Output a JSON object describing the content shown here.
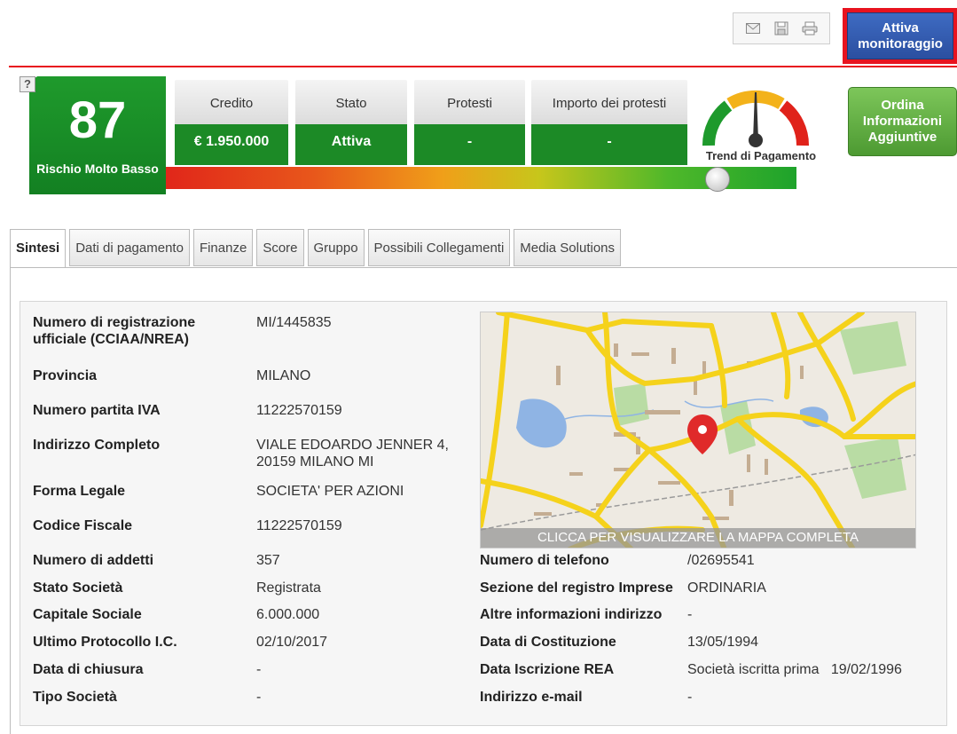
{
  "toolbar": {
    "icons": [
      "mail-icon",
      "save-icon",
      "print-icon"
    ],
    "monitor_button": "Attiva monitoraggio"
  },
  "score": {
    "help": "?",
    "value": "87",
    "label": "Rischio Molto Basso"
  },
  "metrics": [
    {
      "title": "Credito",
      "value": "€ 1.950.000"
    },
    {
      "title": "Stato",
      "value": "Attiva"
    },
    {
      "title": "Protesti",
      "value": "-"
    },
    {
      "title": "Importo dei protesti",
      "value": "-"
    }
  ],
  "gauge": {
    "label": "Trend di Pagamento"
  },
  "order_button": "Ordina Informazioni Aggiuntive",
  "tabs": [
    "Sintesi",
    "Dati di pagamento",
    "Finanze",
    "Score",
    "Gruppo",
    "Possibili Collegamenti",
    "Media Solutions"
  ],
  "active_tab": "Sintesi",
  "details_left": [
    {
      "label": "Numero di registrazione ufficiale (CCIAA/NREA)",
      "value": "MI/1445835"
    },
    {
      "label": "Provincia",
      "value": "MILANO"
    },
    {
      "label": "Numero partita IVA",
      "value": "11222570159"
    },
    {
      "label": "Indirizzo Completo",
      "value": "VIALE EDOARDO JENNER 4, 20159 MILANO MI"
    },
    {
      "label": "Forma Legale",
      "value": "SOCIETA' PER AZIONI"
    },
    {
      "label": "Codice Fiscale",
      "value": "11222570159"
    },
    {
      "label": "Numero di addetti",
      "value": "357"
    },
    {
      "label": "Stato Società",
      "value": "Registrata"
    },
    {
      "label": "Capitale Sociale",
      "value": "6.000.000"
    },
    {
      "label": "Ultimo Protocollo I.C.",
      "value": "02/10/2017"
    },
    {
      "label": "Data di chiusura",
      "value": "-"
    },
    {
      "label": "Tipo Società",
      "value": "-"
    }
  ],
  "details_right": [
    {
      "label": "Numero di telefono",
      "value": "/02695541"
    },
    {
      "label": "Sezione del registro Imprese",
      "value": "ORDINARIA"
    },
    {
      "label": "Altre informazioni indirizzo",
      "value": "-"
    },
    {
      "label": "Data di Costituzione",
      "value": "13/05/1994"
    },
    {
      "label": "Data Iscrizione REA",
      "value": "Società iscritta prima   19/02/1996"
    },
    {
      "label": "Indirizzo e-mail",
      "value": "-"
    }
  ],
  "map": {
    "caption": "CLICCA PER VISUALIZZARE LA MAPPA COMPLETA"
  },
  "colors": {
    "accent_red": "#e8131f",
    "score_green": "#1c8a26",
    "button_blue": "#2b4fa0",
    "road_yellow": "#f5d21b"
  }
}
